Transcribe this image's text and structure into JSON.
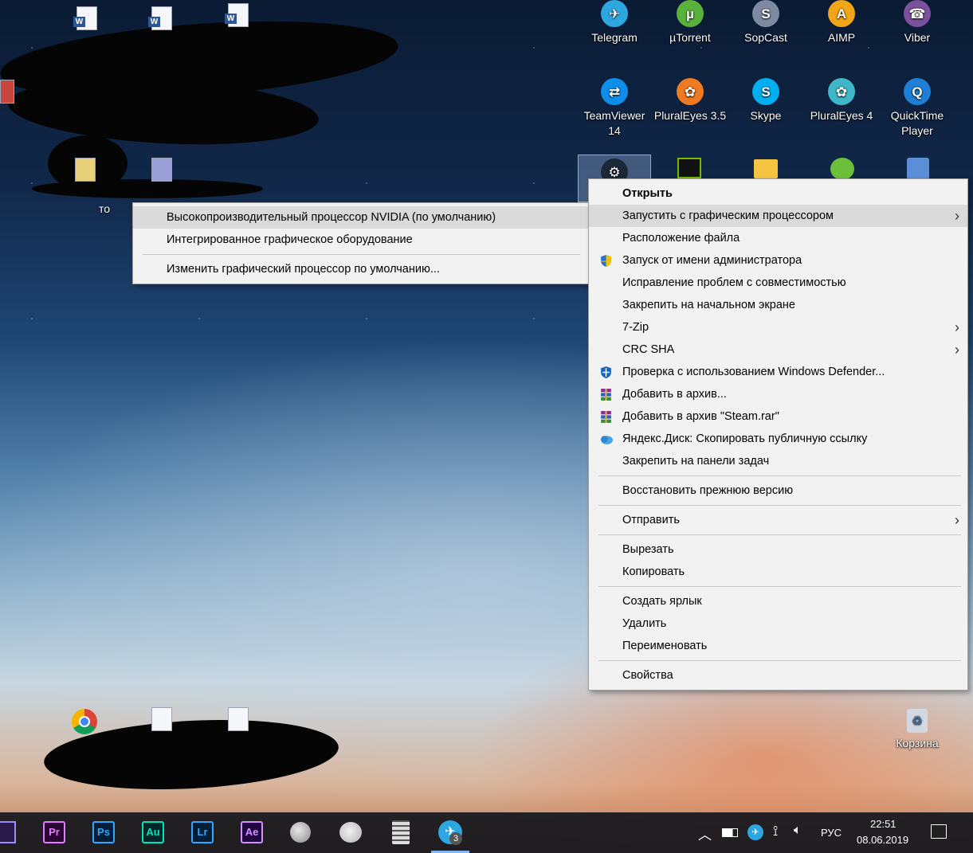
{
  "desktop": {
    "top_icons": [
      {
        "label": "Telegram",
        "color": "#2ea6df",
        "glyph": "✈"
      },
      {
        "label": "µTorrent",
        "color": "#59b33b",
        "glyph": "µ"
      },
      {
        "label": "SopCast",
        "color": "#7e8aa2",
        "glyph": "S"
      },
      {
        "label": "AIMP",
        "color": "#f2a516",
        "glyph": "A"
      },
      {
        "label": "Viber",
        "color": "#7b519d",
        "glyph": "☎"
      }
    ],
    "second_row_icons": [
      {
        "label": "TeamViewer 14",
        "color": "#0e8ee9",
        "glyph": "⇄"
      },
      {
        "label": "PluralEyes 3.5",
        "color": "#f07a22",
        "glyph": "✿"
      },
      {
        "label": "Skype",
        "color": "#00aff0",
        "glyph": "S"
      },
      {
        "label": "PluralEyes 4",
        "color": "#3fb7c9",
        "glyph": "✿"
      },
      {
        "label": "QuickTime Player",
        "color": "#1f7fd6",
        "glyph": "Q"
      }
    ],
    "left_label_partial": "то",
    "recycle_bin_label": "Корзина"
  },
  "context_menu": {
    "items": [
      {
        "label": "Открыть",
        "bold": true
      },
      {
        "label": "Запустить с графическим процессором",
        "submenu": true,
        "hover": true
      },
      {
        "label": "Расположение файла"
      },
      {
        "label": "Запуск от имени администратора",
        "icon": "shield-uac-icon"
      },
      {
        "label": "Исправление проблем с совместимостью"
      },
      {
        "label": "Закрепить на начальном экране"
      },
      {
        "label": "7-Zip",
        "submenu": true
      },
      {
        "label": "CRC SHA",
        "submenu": true
      },
      {
        "label": "Проверка с использованием Windows Defender...",
        "icon": "defender-icon"
      },
      {
        "label": "Добавить в архив...",
        "icon": "winrar-icon"
      },
      {
        "label": "Добавить в архив \"Steam.rar\"",
        "icon": "winrar-icon"
      },
      {
        "label": "Яндекс.Диск: Скопировать публичную ссылку",
        "icon": "yandex-disk-icon"
      },
      {
        "label": "Закрепить на панели задач"
      }
    ],
    "group2": [
      {
        "label": "Восстановить прежнюю версию"
      }
    ],
    "group3": [
      {
        "label": "Отправить",
        "submenu": true
      }
    ],
    "group4": [
      {
        "label": "Вырезать"
      },
      {
        "label": "Копировать"
      }
    ],
    "group5": [
      {
        "label": "Создать ярлык"
      },
      {
        "label": "Удалить"
      },
      {
        "label": "Переименовать"
      }
    ],
    "group6": [
      {
        "label": "Свойства"
      }
    ]
  },
  "gpu_submenu": {
    "items": [
      {
        "label": "Высокопроизводительный процессор NVIDIA (по умолчанию)",
        "hover": true
      },
      {
        "label": "Интегрированное графическое оборудование"
      }
    ],
    "footer": "Изменить графический процессор по умолчанию..."
  },
  "taskbar": {
    "apps": [
      {
        "label": "Pr",
        "color": "#e77bff",
        "bg": "#2a0634"
      },
      {
        "label": "Ps",
        "color": "#31a8ff",
        "bg": "#001e36"
      },
      {
        "label": "Au",
        "color": "#00e4bb",
        "bg": "#00262a"
      },
      {
        "label": "Lr",
        "color": "#31a8ff",
        "bg": "#001e36"
      },
      {
        "label": "Ae",
        "color": "#d291ff",
        "bg": "#1f0740"
      }
    ],
    "telegram_badge": "3",
    "language": "РУС",
    "time": "22:51",
    "date": "08.06.2019"
  }
}
